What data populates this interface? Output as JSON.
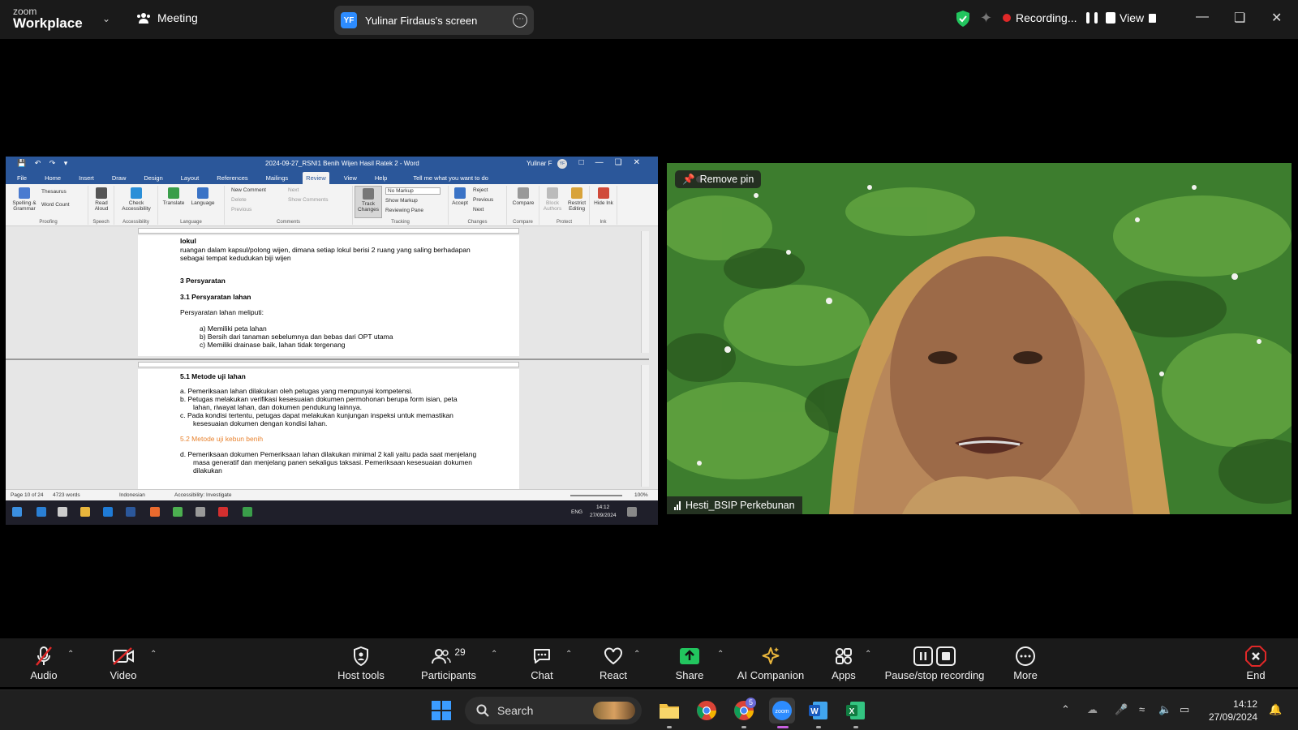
{
  "app": {
    "brand_top": "zoom",
    "brand_bottom": "Workplace",
    "meeting_label": "Meeting",
    "screen_initials": "YF",
    "screen_label": "Yulinar Firdaus's screen",
    "recording_label": "Recording...",
    "view_label": "View"
  },
  "word": {
    "title": "2024-09-27_RSNI1 Benih Wijen Hasil Ratek 2  -  Word",
    "user": "Yulinar F",
    "user_initials": "YF",
    "tabs": [
      "File",
      "Home",
      "Insert",
      "Draw",
      "Design",
      "Layout",
      "References",
      "Mailings",
      "Review",
      "View",
      "Help"
    ],
    "tell_me": "Tell me what you want to do",
    "ribbon": {
      "spelling": "Spelling & Grammar",
      "thesaurus": "Thesaurus",
      "word_count": "Word Count",
      "proofing": "Proofing",
      "read_aloud": "Read Aloud",
      "speech": "Speech",
      "check_accessibility": "Check Accessibility",
      "accessibility": "Accessibility",
      "translate": "Translate",
      "language_btn": "Language",
      "language": "Language",
      "new_comment": "New Comment",
      "delete": "Delete",
      "previous_c": "Previous",
      "next_c": "Next",
      "show_comments": "Show Comments",
      "comments": "Comments",
      "track_changes": "Track Changes",
      "no_markup": "No Markup",
      "show_markup": "Show Markup",
      "reviewing_pane": "Reviewing Pane",
      "tracking": "Tracking",
      "accept": "Accept",
      "reject": "Reject",
      "previous": "Previous",
      "next": "Next",
      "changes": "Changes",
      "compare_btn": "Compare",
      "compare": "Compare",
      "block_authors": "Block Authors",
      "restrict_editing": "Restrict Editing",
      "protect": "Protect",
      "hide_ink": "Hide Ink",
      "ink": "Ink"
    },
    "pane1": {
      "heading": "lokul",
      "line1": "ruangan dalam kapsul/polong wijen, dimana setiap lokul berisi 2 ruang yang saling berhadapan",
      "line2": "sebagai tempat kedudukan biji wijen",
      "sec3": "3    Persyaratan",
      "sec31": "3.1   Persyaratan lahan",
      "intro": "Persyaratan lahan meliputi:",
      "a": "a)   Memiliki peta lahan",
      "b": "b)   Bersih dari tanaman sebelumnya dan bebas dari OPT utama",
      "c": "c)   Memiliki drainase baik, lahan tidak tergenang"
    },
    "pane2": {
      "heading": "5.1 Metode uji lahan",
      "a": "a.    Pemeriksaan lahan dilakukan oleh petugas yang mempunyai kompetensi.",
      "b1": "b.    Petugas melakukan verifikasi kesesuaian dokumen permohonan berupa form isian, peta",
      "b2": "lahan, riwayat lahan, dan dokumen pendukung lainnya.",
      "c1": "c.    Pada kondisi tertentu, petugas dapat melakukan kunjungan inspeksi untuk memastikan",
      "c2": "kesesuaian dokumen dengan kondisi lahan.",
      "sub": "5.2 Metode uji kebun benih",
      "d1": "d.    Pemeriksaan dokumen Pemeriksaan lahan dilakukan minimal 2 kali yaitu pada saat menjelang",
      "d2": "masa generatif dan menjelang panen sekaligus taksasi. Pemeriksaan kesesuaian dokumen",
      "d3": "dilakukan"
    },
    "status": {
      "page": "Page 10 of 24",
      "words": "4723 words",
      "language": "Indonesian",
      "accessibility": "Accessibility: Investigate",
      "zoom": "100%"
    },
    "taskbar": {
      "lang": "ENG",
      "time": "14:12",
      "date": "27/09/2024"
    }
  },
  "video": {
    "remove_pin": "Remove pin",
    "participant_name": "Hesti_BSIP Perkebunan"
  },
  "toolbar": {
    "audio": "Audio",
    "video": "Video",
    "host_tools": "Host tools",
    "participants": "Participants",
    "participants_count": "29",
    "chat": "Chat",
    "react": "React",
    "share": "Share",
    "ai_companion": "AI Companion",
    "apps": "Apps",
    "pause_stop": "Pause/stop recording",
    "more": "More",
    "end": "End"
  },
  "taskbar": {
    "search": "Search",
    "chrome_badge": "5",
    "time": "14:12",
    "date": "27/09/2024"
  },
  "colors": {
    "zoom_blue": "#2d8cff",
    "word_blue": "#2b579a",
    "recording_red": "#e02828",
    "share_green": "#22c55e",
    "end_red": "#e02828",
    "ai_gold": "#e8b53c"
  }
}
